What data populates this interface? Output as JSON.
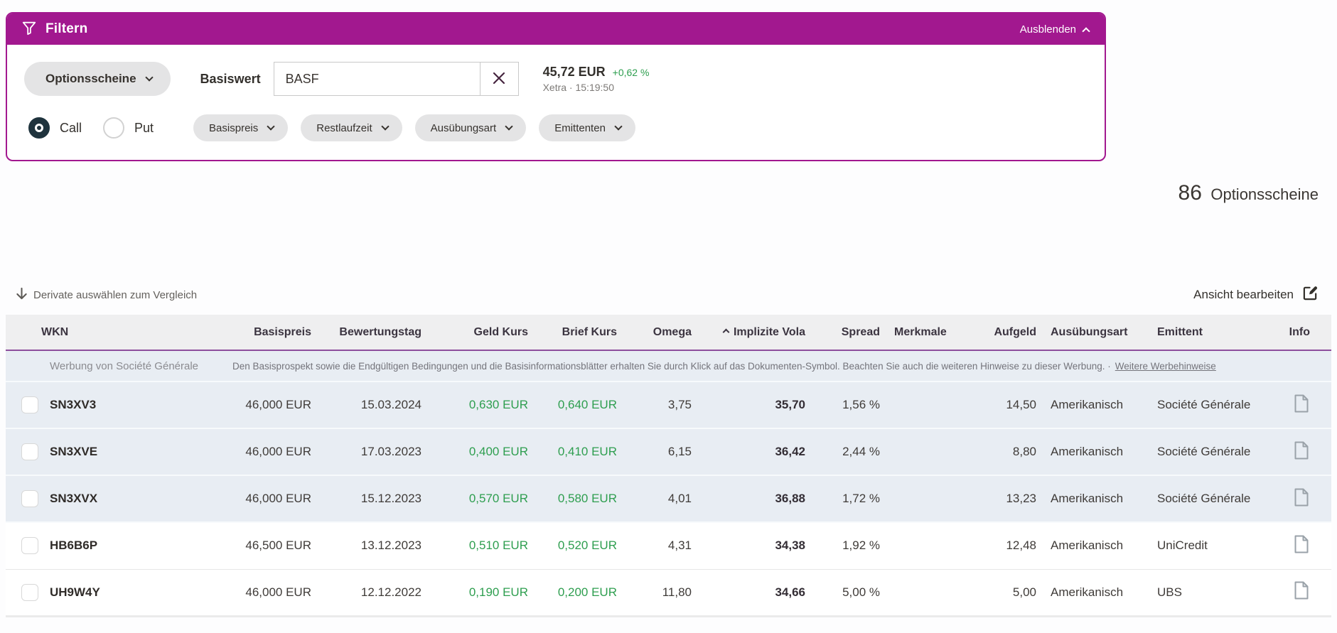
{
  "filter_panel": {
    "title": "Filtern",
    "hide_label": "Ausblenden",
    "type_select": {
      "label": "Optionsscheine"
    },
    "basiswert": {
      "label": "Basiswert",
      "value": "BASF"
    },
    "quote": {
      "price": "45,72 EUR",
      "change": "+0,62 %",
      "venue_time": "Xetra · 15:19:50"
    },
    "option_type": {
      "call": "Call",
      "put": "Put",
      "selected": "Call"
    },
    "filter_pills": [
      {
        "label": "Basispreis"
      },
      {
        "label": "Restlaufzeit"
      },
      {
        "label": "Ausübungsart"
      },
      {
        "label": "Emittenten"
      }
    ]
  },
  "result_count": {
    "number": "86",
    "label": "Optionsscheine"
  },
  "toolbar": {
    "compare_label": "Derivate auswählen zum Vergleich",
    "edit_view_label": "Ansicht bearbeiten"
  },
  "table": {
    "columns": [
      "WKN",
      "Basispreis",
      "Bewertungstag",
      "Geld Kurs",
      "Brief Kurs",
      "Omega",
      "Implizite Vola",
      "Spread",
      "Merkmale",
      "Aufgeld",
      "Ausübungsart",
      "Emittent",
      "Info"
    ],
    "sort": {
      "column": "Implizite Vola",
      "direction": "asc"
    },
    "ad_banner": {
      "source": "Werbung von Société Générale",
      "text": "Den Basisprospekt sowie die Endgültigen Bedingungen und die Basisinformationsblätter erhalten Sie durch Klick auf das Dokumenten-Symbol. Beachten Sie auch die weiteren Hinweise zu dieser Werbung. ·",
      "link": "Weitere Werbehinweise"
    },
    "rows": [
      {
        "wkn": "SN3XV3",
        "basispreis": "46,000 EUR",
        "bewertungstag": "15.03.2024",
        "geld": "0,630 EUR",
        "brief": "0,640 EUR",
        "omega": "3,75",
        "vola": "35,70",
        "spread": "1,56 %",
        "merkmale": "",
        "aufgeld": "14,50",
        "ausuebungsart": "Amerikanisch",
        "emittent": "Société Générale",
        "is_ad": true
      },
      {
        "wkn": "SN3XVE",
        "basispreis": "46,000 EUR",
        "bewertungstag": "17.03.2023",
        "geld": "0,400 EUR",
        "brief": "0,410 EUR",
        "omega": "6,15",
        "vola": "36,42",
        "spread": "2,44 %",
        "merkmale": "",
        "aufgeld": "8,80",
        "ausuebungsart": "Amerikanisch",
        "emittent": "Société Générale",
        "is_ad": true
      },
      {
        "wkn": "SN3XVX",
        "basispreis": "46,000 EUR",
        "bewertungstag": "15.12.2023",
        "geld": "0,570 EUR",
        "brief": "0,580 EUR",
        "omega": "4,01",
        "vola": "36,88",
        "spread": "1,72 %",
        "merkmale": "",
        "aufgeld": "13,23",
        "ausuebungsart": "Amerikanisch",
        "emittent": "Société Générale",
        "is_ad": true
      },
      {
        "wkn": "HB6B6P",
        "basispreis": "46,500 EUR",
        "bewertungstag": "13.12.2023",
        "geld": "0,510 EUR",
        "brief": "0,520 EUR",
        "omega": "4,31",
        "vola": "34,38",
        "spread": "1,92 %",
        "merkmale": "",
        "aufgeld": "12,48",
        "ausuebungsart": "Amerikanisch",
        "emittent": "UniCredit",
        "is_ad": false
      },
      {
        "wkn": "UH9W4Y",
        "basispreis": "46,000 EUR",
        "bewertungstag": "12.12.2022",
        "geld": "0,190 EUR",
        "brief": "0,200 EUR",
        "omega": "11,80",
        "vola": "34,66",
        "spread": "5,00 %",
        "merkmale": "",
        "aufgeld": "5,00",
        "ausuebungsart": "Amerikanisch",
        "emittent": "UBS",
        "is_ad": false
      }
    ]
  },
  "icons": {
    "filter": "funnel-icon",
    "hide": "chevron-up-icon",
    "dropdown": "chevron-down-icon",
    "clear_input": "close-x-icon",
    "sort": "chevron-up-icon",
    "compare": "arrow-down-icon",
    "edit_view": "edit-square-icon",
    "info": "document-icon"
  },
  "colors": {
    "brand_magenta": "#a2188f",
    "positive_green": "#2e9e4f",
    "ad_row_background": "#e8edf3",
    "header_underline": "#8d4f9d",
    "radio_selected": "#1f333d"
  }
}
